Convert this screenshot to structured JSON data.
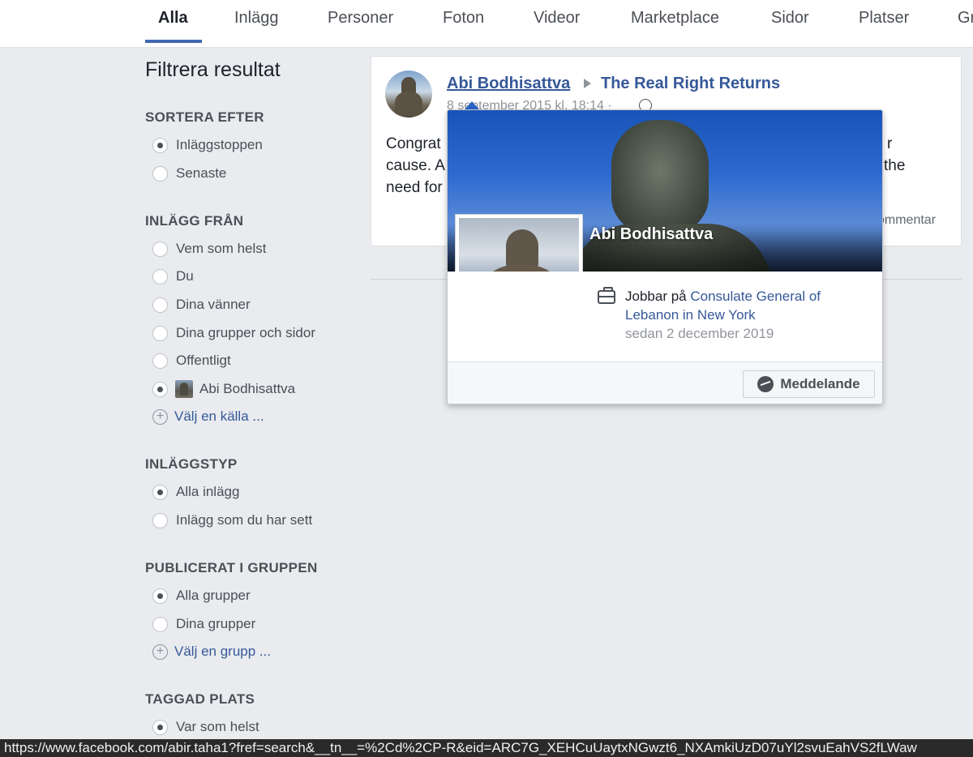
{
  "tabs": {
    "items": [
      "Alla",
      "Inlägg",
      "Personer",
      "Foton",
      "Videor",
      "Marketplace",
      "Sidor",
      "Platser",
      "Gr"
    ],
    "active": "Alla"
  },
  "sidebar": {
    "title": "Filtrera resultat",
    "sort": {
      "heading": "SORTERA EFTER",
      "options": [
        "Inläggstoppen",
        "Senaste"
      ],
      "selected": "Inläggstoppen"
    },
    "from": {
      "heading": "INLÄGG FRÅN",
      "options": [
        "Vem som helst",
        "Du",
        "Dina vänner",
        "Dina grupper och sidor",
        "Offentligt",
        "Abi Bodhisattva"
      ],
      "selected": "Abi Bodhisattva",
      "add_label": "Välj en källa ..."
    },
    "type": {
      "heading": "INLÄGGSTYP",
      "options": [
        "Alla inlägg",
        "Inlägg som du har sett"
      ],
      "selected": "Alla inlägg"
    },
    "group": {
      "heading": "PUBLICERAT I GRUPPEN",
      "options": [
        "Alla grupper",
        "Dina grupper"
      ],
      "selected": "Alla grupper",
      "add_label": "Välj en grupp ..."
    },
    "place": {
      "heading": "TAGGAD PLATS",
      "options": [
        "Var som helst"
      ],
      "selected": "Var som helst"
    }
  },
  "post": {
    "author": "Abi Bodhisattva",
    "target_page": "The Real Right Returns",
    "date": "8 september 2015 kl. 18:14 ·",
    "body_left": [
      "Congrat",
      "cause. A",
      "need for"
    ],
    "body_right": [
      "r",
      "the"
    ],
    "comment_label": "ommentar"
  },
  "hovercard": {
    "name": "Abi Bodhisattva",
    "work_prefix": "Jobbar på",
    "work_employer_1": "Consulate General of",
    "work_employer_2": "Lebanon in New York",
    "work_since": "sedan 2 december 2019",
    "message_button": "Meddelande"
  },
  "status_url": "https://www.facebook.com/abir.taha1?fref=search&__tn__=%2Cd%2CP-R&eid=ARC7G_XEHCuUaytxNGwzt6_NXAmkiUzD07uYl2svuEahVS2fLWaw",
  "colors": {
    "link": "#365899",
    "accent": "#4267b2",
    "background": "#e9ebee"
  }
}
